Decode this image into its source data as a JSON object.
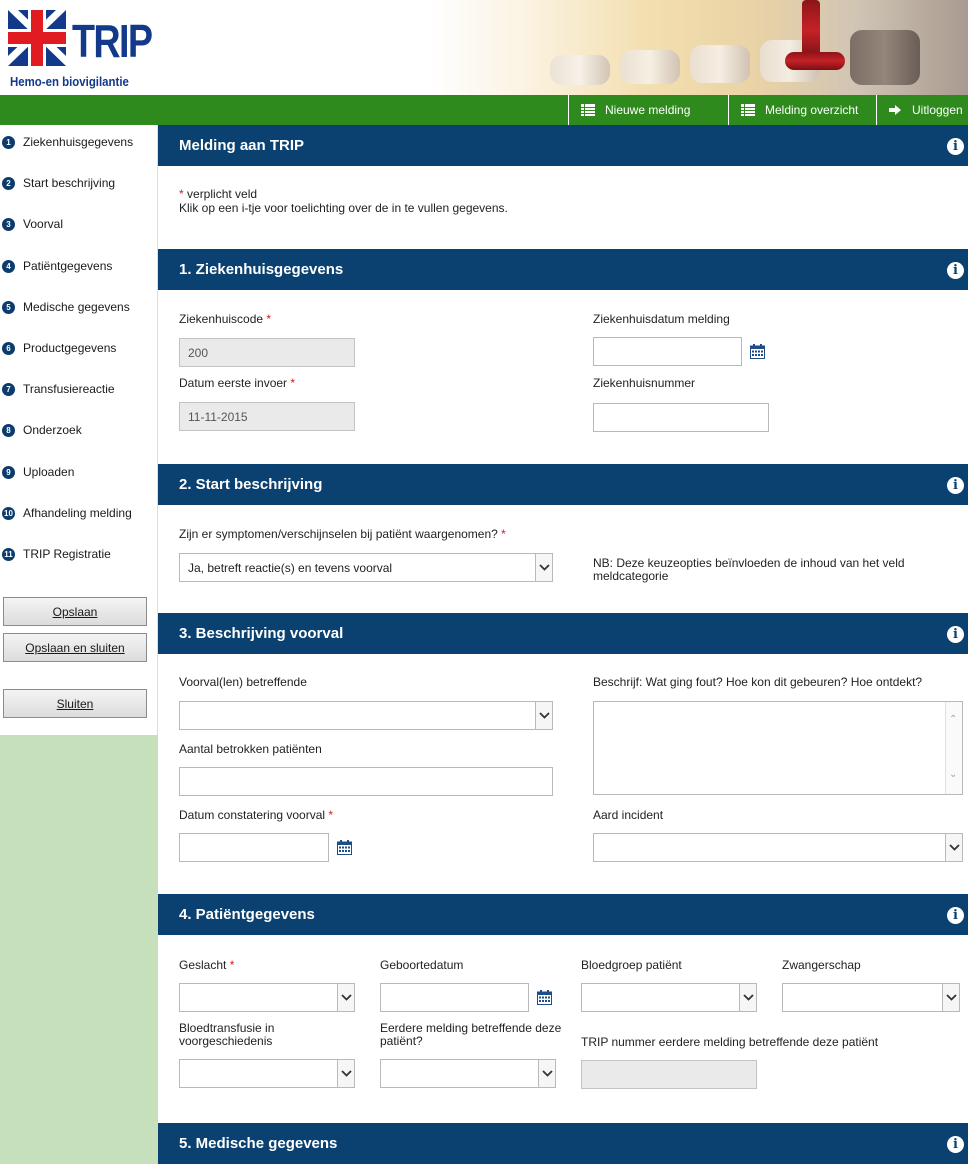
{
  "header": {
    "logo_text": "TRIP",
    "logo_subtitle": "Hemo-en biovigilantie"
  },
  "topnav": {
    "new_report": "Nieuwe melding",
    "report_overview": "Melding overzicht",
    "logout": "Uitloggen"
  },
  "sidebar": {
    "steps": [
      {
        "num": "1",
        "label": "Ziekenhuisgegevens"
      },
      {
        "num": "2",
        "label": "Start beschrijving"
      },
      {
        "num": "3",
        "label": "Voorval"
      },
      {
        "num": "4",
        "label": "Patiëntgegevens"
      },
      {
        "num": "5",
        "label": "Medische gegevens"
      },
      {
        "num": "6",
        "label": "Productgegevens"
      },
      {
        "num": "7",
        "label": "Transfusiereactie"
      },
      {
        "num": "8",
        "label": "Onderzoek"
      },
      {
        "num": "9",
        "label": "Uploaden"
      },
      {
        "num": "10",
        "label": "Afhandeling melding"
      },
      {
        "num": "11",
        "label": "TRIP Registratie"
      }
    ],
    "save": "Opslaan",
    "save_close": "Opslaan en sluiten",
    "close": "Sluiten"
  },
  "intro": {
    "title": "Melding aan TRIP",
    "required_mark": "*",
    "required_text": "verplicht veld",
    "info_text": "Klik op een i-tje voor toelichting over de in te vullen gegevens."
  },
  "s1": {
    "title": "1. Ziekenhuisgegevens",
    "hospital_code_label": "Ziekenhuiscode",
    "hospital_code_value": "200",
    "first_entry_label": "Datum eerste invoer",
    "first_entry_value": "11-11-2015",
    "report_date_label": "Ziekenhuisdatum melding",
    "report_date_value": "",
    "hospital_number_label": "Ziekenhuisnummer",
    "hospital_number_value": ""
  },
  "s2": {
    "title": "2. Start beschrijving",
    "symptoms_label": "Zijn er symptomen/verschijnselen bij patiënt waargenomen?",
    "symptoms_value": "Ja, betreft reactie(s) en tevens voorval",
    "note": "NB: Deze keuzeopties beïnvloeden de inhoud van het veld meldcategorie"
  },
  "s3": {
    "title": "3. Beschrijving voorval",
    "incidents_label": "Voorval(len) betreffende",
    "incidents_value": "",
    "patients_label": "Aantal betrokken patiënten",
    "patients_value": "",
    "detect_date_label": "Datum constatering voorval",
    "detect_date_value": "",
    "describe_label": "Beschrijf: Wat ging fout? Hoe kon dit gebeuren? Hoe ontdekt?",
    "incident_type_label": "Aard incident",
    "incident_type_value": ""
  },
  "s4": {
    "title": "4. Patiëntgegevens",
    "gender_label": "Geslacht",
    "birthdate_label": "Geboortedatum",
    "bloodgroup_label": "Bloedgroep patiënt",
    "pregnancy_label": "Zwangerschap",
    "transfusion_history_label": "Bloedtransfusie in voorgeschiedenis",
    "previous_report_label": "Eerdere melding betreffende deze patiënt?",
    "trip_number_label": "TRIP nummer eerdere melding betreffende deze patiënt"
  },
  "s5": {
    "title": "5. Medische gegevens"
  },
  "colors": {
    "header_blue": "#0a4170",
    "nav_green": "#2f8a1d",
    "sidebar_green": "#c7e0bc",
    "required_red": "#e4121a"
  }
}
